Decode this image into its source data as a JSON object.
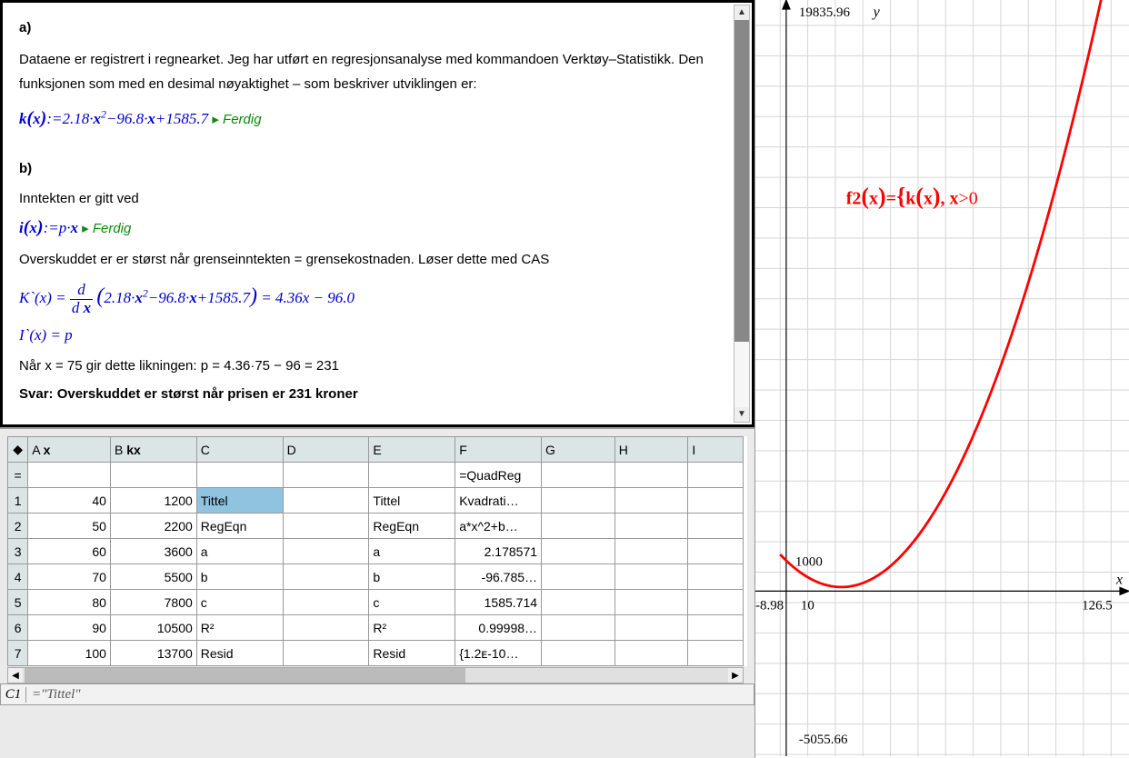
{
  "notes": {
    "a_label": "a)",
    "a_text": "Dataene er registrert i regnearket. Jeg har utført en regresjonsanalyse med kommandoen Verktøy–Statistikk. Den funksjonen som med en desimal nøyaktighet – som  beskriver utviklingen er:",
    "k_def": "k(x):=2.18·x²−96.8·x+1585.7",
    "ferdig": "Ferdig",
    "b_label": "b)",
    "b_text1": "Inntekten er gitt ved",
    "i_def": "i(x):=p·x",
    "b_text2": "Overskuddet er er størst når grenseinntekten = grensekostnaden. Løser dette med CAS",
    "kprime_lhs": "K`(x) = ",
    "kprime_inner": "2.18·x²−96.8·x+1585.7",
    "kprime_rhs": " = 4.36x − 96.0",
    "iprime": "I`(x) = p",
    "b_text3": "Når x = 75 gir dette likningen:  p = 4.36·75 − 96 = 231",
    "svar": "Svar: Overskuddet er størst når prisen er 231 kroner"
  },
  "sheet": {
    "col_headers": [
      "",
      "A",
      "B",
      "C",
      "D",
      "E",
      "F",
      "G",
      "H",
      "I"
    ],
    "name_row": [
      "",
      "x",
      "kx",
      "",
      "",
      "",
      "",
      "",
      "",
      ""
    ],
    "formula_row": [
      "=",
      "",
      "",
      "",
      "",
      "",
      "=QuadReg",
      "",
      "",
      ""
    ],
    "rows": [
      [
        "1",
        "40",
        "1200",
        "Tittel",
        "",
        "Tittel",
        "Kvadrati…",
        "",
        "",
        ""
      ],
      [
        "2",
        "50",
        "2200",
        "RegEqn",
        "",
        "RegEqn",
        "a*x^2+b…",
        "",
        "",
        ""
      ],
      [
        "3",
        "60",
        "3600",
        "a",
        "",
        "a",
        "2.178571",
        "",
        "",
        ""
      ],
      [
        "4",
        "70",
        "5500",
        "b",
        "",
        "b",
        "-96.785…",
        "",
        "",
        ""
      ],
      [
        "5",
        "80",
        "7800",
        "c",
        "",
        "c",
        "1585.714",
        "",
        "",
        ""
      ],
      [
        "6",
        "90",
        "10500",
        "R²",
        "",
        "R²",
        "0.99998…",
        "",
        "",
        ""
      ],
      [
        "7",
        "100",
        "13700",
        "Resid",
        "",
        "Resid",
        "{1.2ᴇ-10…",
        "",
        "",
        ""
      ]
    ],
    "formula_bar_ref": "C1",
    "formula_bar_value": "=\"Tittel\""
  },
  "graph": {
    "y_max_label": "19835.96",
    "y_axis": "y",
    "x_axis": "x",
    "x_min_label": "-8.98",
    "x_tick_10": "10",
    "x_max_label": "126.5",
    "y_tick_1000": "1000",
    "y_min_label": "-5055.66",
    "fn_label_pre": "f2",
    "fn_label_x": "x",
    "fn_label_eq": "=",
    "fn_label_brace": "{",
    "fn_label_k": "k",
    "fn_label_cond": ", x>0"
  },
  "chart_data": {
    "type": "line",
    "title": "f2(x)={k(x), x>0",
    "xlabel": "x",
    "ylabel": "y",
    "xlim": [
      -8.98,
      126.5
    ],
    "ylim": [
      -5055.66,
      19835.96
    ],
    "series": [
      {
        "name": "k(x)=2.18x²−96.8x+1585.7",
        "x": [
          0,
          10,
          20,
          30,
          40,
          50,
          60,
          70,
          80,
          90,
          100,
          110,
          120,
          126.5
        ],
        "values": [
          1585.7,
          835.7,
          521.7,
          643.7,
          1201.7,
          2195.7,
          3625.7,
          5491.7,
          7793.7,
          10531.7,
          13705.7,
          17315.7,
          21361.7,
          24226.0
        ]
      }
    ]
  }
}
